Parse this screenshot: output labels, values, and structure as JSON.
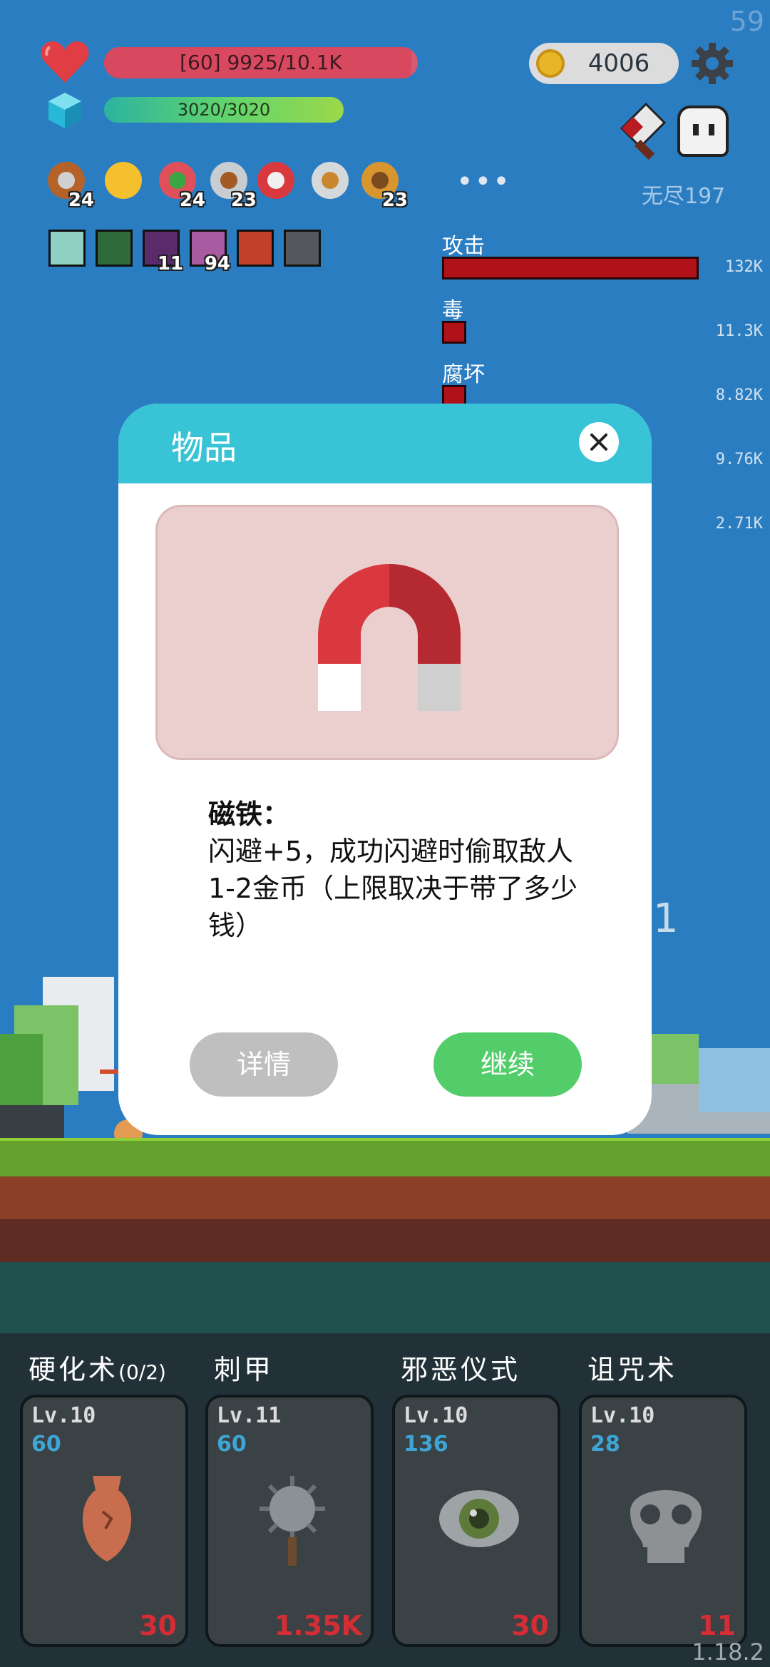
{
  "fps": "59",
  "hp": {
    "text": "[60] 9925/10.1K",
    "fraction": 0.98
  },
  "mp": {
    "text": "3020/3020",
    "fraction": 1.0
  },
  "coins": "4006",
  "mode_label": "无尽197",
  "more_dots": "•••",
  "items": [
    {
      "icon": "shield-icon",
      "count": "24"
    },
    {
      "icon": "sun-icon",
      "count": ""
    },
    {
      "icon": "watermelon-icon",
      "count": "24"
    },
    {
      "icon": "sword-icon",
      "count": "23"
    },
    {
      "icon": "magnet-icon",
      "count": ""
    },
    {
      "icon": "dagger-icon",
      "count": ""
    },
    {
      "icon": "book-icon",
      "count": "23"
    }
  ],
  "buffs": [
    {
      "icon": "light-buff-icon",
      "count": ""
    },
    {
      "icon": "poison-buff-icon",
      "count": ""
    },
    {
      "icon": "dark-buff-icon",
      "count": "11"
    },
    {
      "icon": "pink-buff-icon",
      "count": "94"
    },
    {
      "icon": "fire-buff-icon",
      "count": ""
    },
    {
      "icon": "shadow-buff-icon",
      "count": ""
    }
  ],
  "damage_stats": [
    {
      "label": "攻击",
      "value": "132K"
    },
    {
      "label": "毒",
      "value": "11.3K"
    },
    {
      "label": "腐坏",
      "value": "8.82K"
    },
    {
      "label": "",
      "value": "9.76K"
    },
    {
      "label": "",
      "value": "2.71K"
    }
  ],
  "background_number": "1",
  "modal": {
    "title": "物品",
    "item_name": "磁铁：",
    "item_desc": "闪避+5，成功闪避时偷取敌人1-2金币（上限取决于带了多少钱）",
    "detail_button": "详情",
    "continue_button": "继续"
  },
  "skills": [
    {
      "title": "硬化术",
      "suffix": "(0/2)",
      "level": "Lv.10",
      "cost": "60",
      "price": "30",
      "icon": "vase-icon"
    },
    {
      "title": "刺甲",
      "suffix": "",
      "level": "Lv.11",
      "cost": "60",
      "price": "1.35K",
      "icon": "spiked-mace-icon"
    },
    {
      "title": "邪恶仪式",
      "suffix": "",
      "level": "Lv.10",
      "cost": "136",
      "price": "30",
      "icon": "eye-icon"
    },
    {
      "title": "诅咒术",
      "suffix": "",
      "level": "Lv.10",
      "cost": "28",
      "price": "11",
      "icon": "skull-icon"
    }
  ],
  "version": "1.18.2",
  "colors": {
    "header": "#38c4d6",
    "continue": "#52cd6a",
    "detail": "#bfbfbf",
    "damage_bar": "#b0121a"
  }
}
